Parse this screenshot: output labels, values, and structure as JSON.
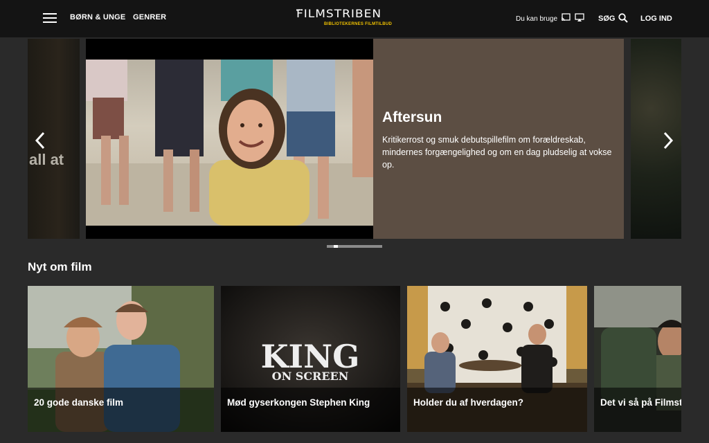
{
  "header": {
    "nav": [
      "BØRN & UNGE",
      "GENRER"
    ],
    "logo_title": "FILMSTRIBEN",
    "logo_subtitle": "BIBLIOTEKERNES FILMTILBUD",
    "usage_label": "Du kan bruge",
    "search_label": "SØG",
    "login_label": "LOG IND"
  },
  "hero": {
    "prev_peek_text": "all at",
    "title": "Aftersun",
    "description": "Kritikerrost og smuk debutspillefilm om forældreskab, mindernes forgængelighed og om en dag pludselig at vokse op."
  },
  "section": {
    "title": "Nyt om film",
    "cards": [
      {
        "caption": "20 gode danske film"
      },
      {
        "caption": "Mød gyserkongen Stephen King",
        "art_line1": "KING",
        "art_line2": "ON SCREEN"
      },
      {
        "caption": "Holder du af hverdagen?"
      },
      {
        "caption": "Det vi så på Filmstriben"
      }
    ]
  },
  "colors": {
    "header_bg": "#141414",
    "page_bg": "#2a2a2a",
    "hero_info_bg": "#5c4e43",
    "logo_accent": "#f2c300"
  }
}
